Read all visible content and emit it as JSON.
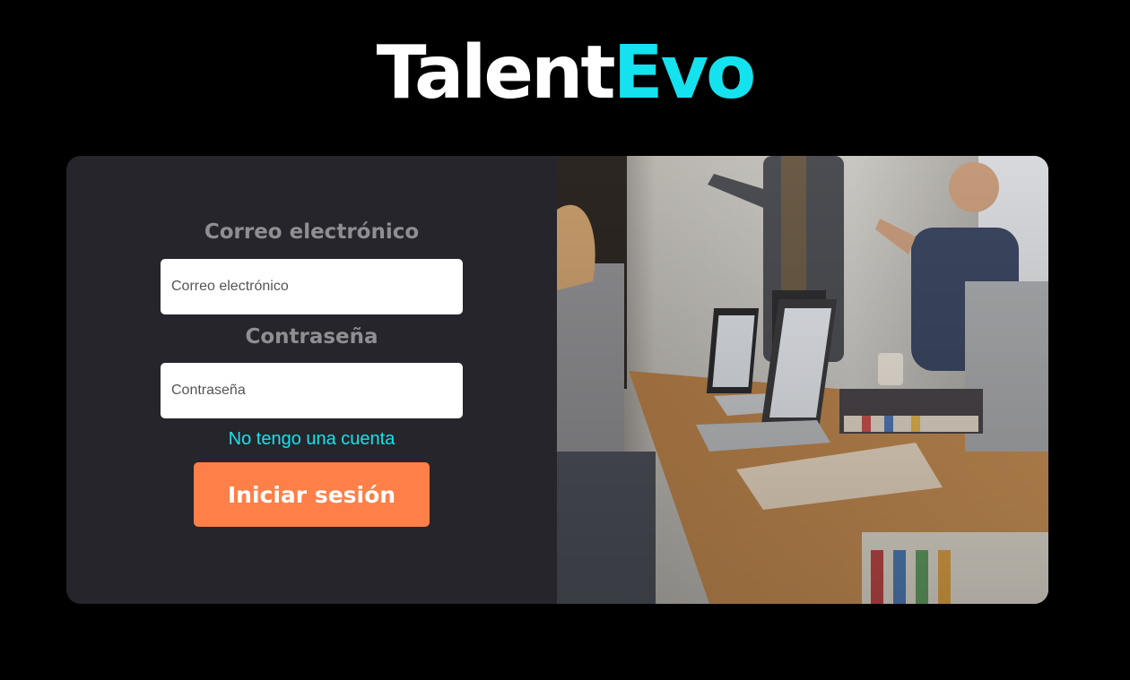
{
  "brand": {
    "part1": "Talent",
    "part2": "Evo"
  },
  "login": {
    "email_label": "Correo electrónico",
    "email_placeholder": "Correo electrónico",
    "email_value": "",
    "password_label": "Contraseña",
    "password_placeholder": "Contraseña",
    "password_value": "",
    "register_link": "No tengo una cuenta",
    "submit_label": "Iniciar sesión"
  },
  "colors": {
    "background": "#000000",
    "panel": "#26252b",
    "accent_cyan": "#14e2ee",
    "button_orange": "#ff7f48",
    "label_gray": "#8f8e93"
  },
  "icons": {
    "photo": "office-meeting-photo"
  }
}
